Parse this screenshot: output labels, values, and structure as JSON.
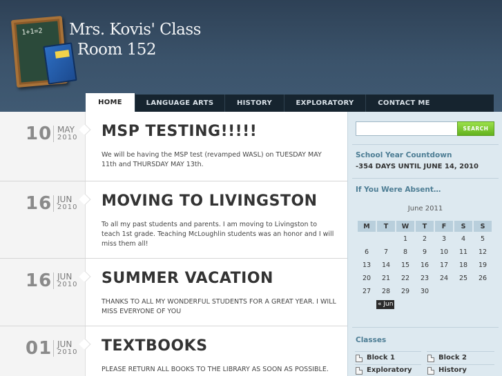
{
  "header": {
    "title_line1": "Mrs. Kovis' Class",
    "title_line2": "Room 152",
    "logo_equation": "1+1=2"
  },
  "nav": {
    "items": [
      "HOME",
      "LANGUAGE ARTS",
      "HISTORY",
      "EXPLORATORY",
      "CONTACT ME"
    ],
    "active": "HOME"
  },
  "posts": [
    {
      "day": "10",
      "month": "MAY",
      "year": "2010",
      "title": "MSP TESTING!!!!!",
      "body": "We will be having the MSP test (revamped WASL) on TUESDAY MAY 11th and THURSDAY MAY 13th."
    },
    {
      "day": "16",
      "month": "JUN",
      "year": "2010",
      "title": "MOVING TO LIVINGSTON",
      "body": "To all my past students and parents.  I am moving to Livingston to teach 1st grade.  Teaching McLoughlin students was an honor and I will miss them all!"
    },
    {
      "day": "16",
      "month": "JUN",
      "year": "2010",
      "title": "SUMMER VACATION",
      "body": "THANKS TO ALL MY WONDERFUL STUDENTS FOR A GREAT YEAR.  I WILL MISS EVERYONE OF YOU"
    },
    {
      "day": "01",
      "month": "JUN",
      "year": "2010",
      "title": "TEXTBOOKS",
      "body": "PLEASE RETURN ALL BOOKS TO THE LIBRARY AS SOON AS POSSIBLE."
    }
  ],
  "sidebar": {
    "search_button": "SEARCH",
    "search_value": "",
    "countdown_title": "School Year Countdown",
    "countdown_text": "-354 DAYS UNTIL JUNE 14, 2010",
    "absent_title": "If You Were Absent…",
    "calendar": {
      "caption": "June 2011",
      "days": [
        "M",
        "T",
        "W",
        "T",
        "F",
        "S",
        "S"
      ],
      "weeks": [
        [
          "",
          "",
          "1",
          "2",
          "3",
          "4",
          "5"
        ],
        [
          "6",
          "7",
          "8",
          "9",
          "10",
          "11",
          "12"
        ],
        [
          "13",
          "14",
          "15",
          "16",
          "17",
          "18",
          "19"
        ],
        [
          "20",
          "21",
          "22",
          "23",
          "24",
          "25",
          "26"
        ],
        [
          "27",
          "28",
          "29",
          "30",
          "",
          "",
          ""
        ]
      ],
      "prev_link": "« Jun"
    },
    "classes_title": "Classes",
    "classes": [
      "Block 1",
      "Block 2",
      "Exploratory",
      "History"
    ]
  },
  "colors": {
    "header_bg": "#3b536b",
    "nav_bg": "#16242f",
    "sidebar_bg": "#dde9f0",
    "accent": "#4d7d94",
    "search_green": "#62b21e"
  }
}
